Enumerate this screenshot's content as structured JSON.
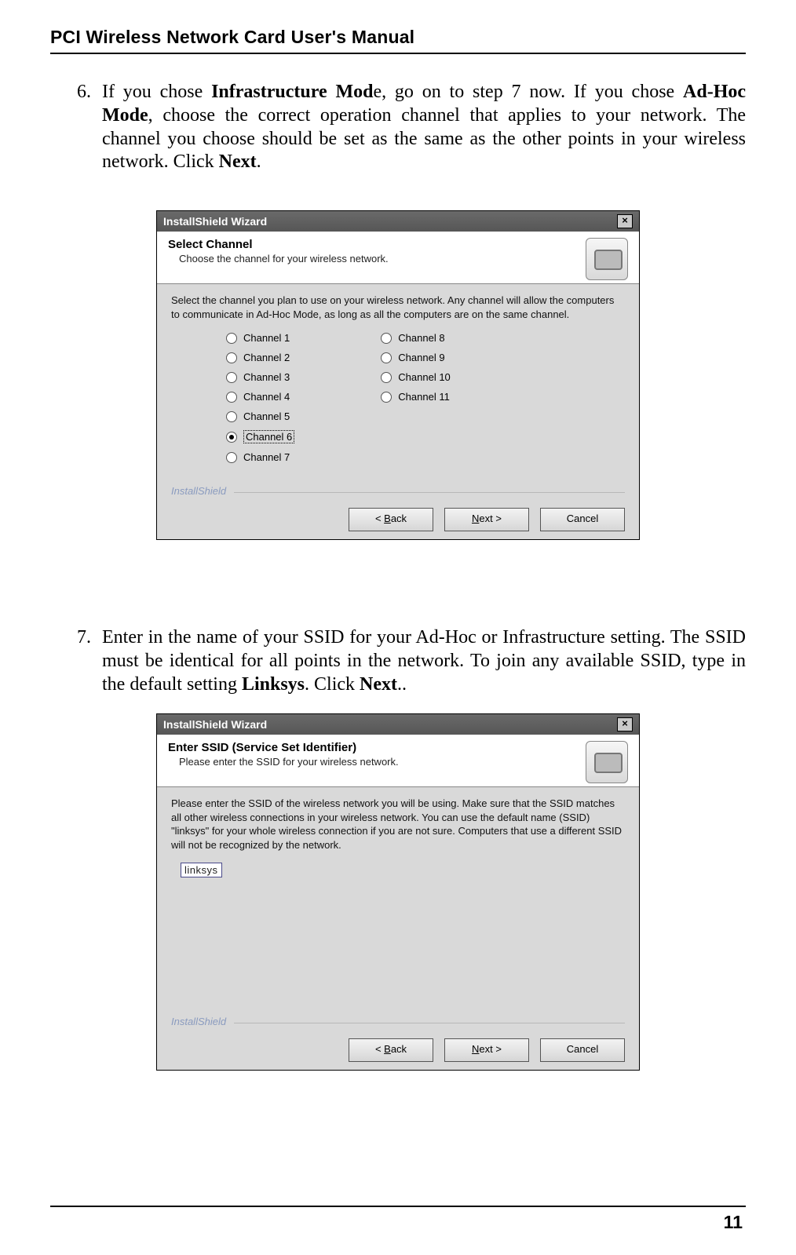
{
  "page": {
    "header": "PCI Wireless Network Card User's Manual",
    "number": "11"
  },
  "steps": [
    {
      "num": "6.",
      "seg": {
        "a": "If you chose ",
        "b": "Infrastructure Mod",
        "c": "e, go on to step 7 now. If you chose ",
        "d": "Ad-Hoc Mode",
        "e": ", choose the correct operation channel that applies to your network. The channel you choose should be set as the same as the other points in your wireless network. Click ",
        "f": "Next",
        "g": "."
      }
    },
    {
      "num": "7.",
      "seg": {
        "a": "Enter in the name of your SSID for your Ad-Hoc or Infrastructure setting. The SSID must be identical for all points in the network. To join any available SSID, type in the default setting ",
        "b": "Linksys",
        "c": ". Click ",
        "d": "Next",
        "e": ".."
      }
    }
  ],
  "dlg1": {
    "title": "InstallShield Wizard",
    "close": "×",
    "head1": "Select Channel",
    "head2": "Choose the channel for your wireless network.",
    "desc": "Select the channel you plan to use on your wireless network. Any channel will allow the computers to communicate in Ad-Hoc Mode, as long as all the computers are on the same channel.",
    "channels_left": [
      "Channel 1",
      "Channel 2",
      "Channel 3",
      "Channel 4",
      "Channel 5",
      "Channel 6",
      "Channel 7"
    ],
    "channels_right": [
      "Channel 8",
      "Channel 9",
      "Channel 10",
      "Channel 11"
    ],
    "selected": "Channel 6",
    "brand": "InstallShield",
    "back_pre": "< ",
    "back_u": "B",
    "back_post": "ack",
    "next_u": "N",
    "next_post": "ext >",
    "cancel": "Cancel"
  },
  "dlg2": {
    "title": "InstallShield Wizard",
    "close": "×",
    "head1": "Enter SSID (Service Set Identifier)",
    "head2": "Please enter the SSID for your wireless network.",
    "desc": "Please enter the SSID of the wireless network you will be using. Make sure that the SSID matches all other wireless connections in your wireless network. You can use the default name (SSID) \"linksys\" for your whole wireless connection if you are not sure. Computers that use a different SSID will not be recognized by the network.",
    "input": "linksys",
    "brand": "InstallShield",
    "back_pre": "< ",
    "back_u": "B",
    "back_post": "ack",
    "next_u": "N",
    "next_post": "ext >",
    "cancel": "Cancel"
  }
}
